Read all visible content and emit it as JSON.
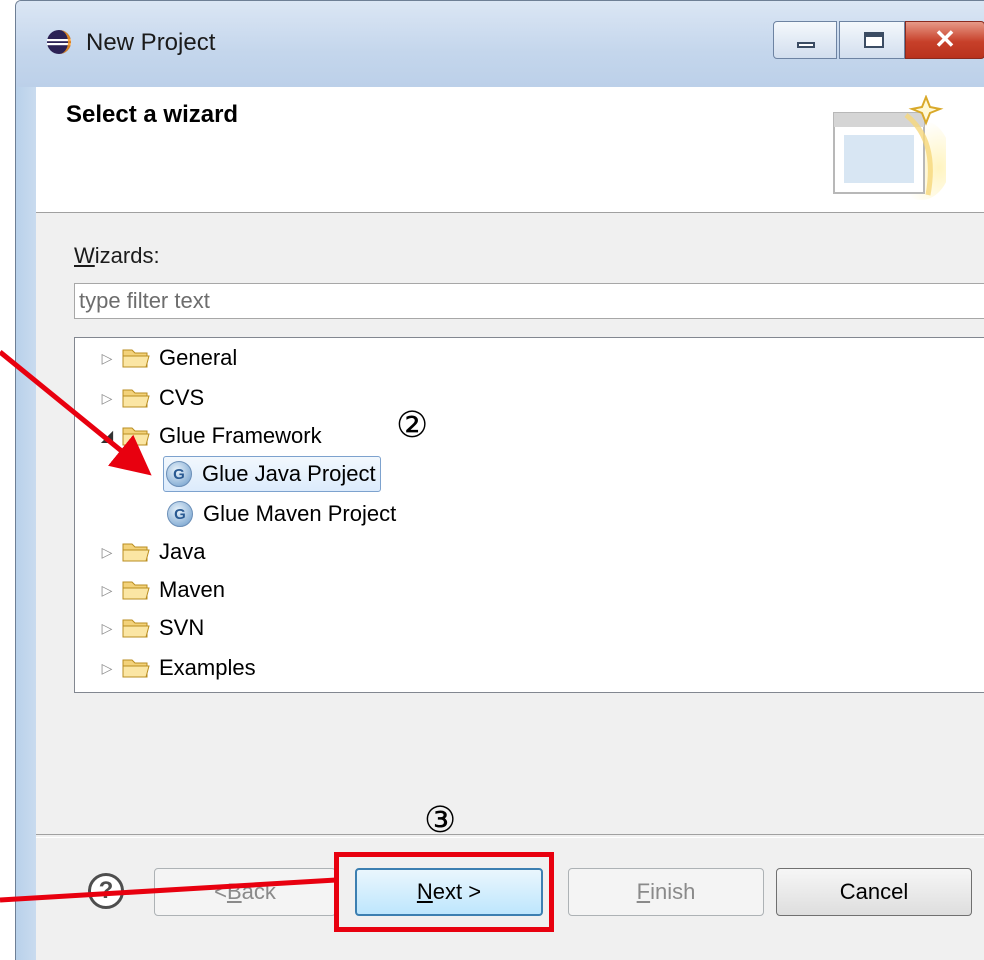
{
  "window": {
    "title": "New Project",
    "buttons": [
      "minimize",
      "maximize",
      "close"
    ],
    "close_glyph": "✕"
  },
  "banner": {
    "title": "Select a wizard"
  },
  "wizards": {
    "label_accel": "W",
    "label_rest": "izards:",
    "filter_placeholder": "type filter text"
  },
  "tree": {
    "items": [
      {
        "label": "General",
        "type": "folder",
        "expanded": false
      },
      {
        "label": "CVS",
        "type": "folder",
        "expanded": false
      },
      {
        "label": "Glue Framework",
        "type": "folder",
        "expanded": true
      },
      {
        "label": "Glue Java Project",
        "type": "wizard",
        "selected": true,
        "icon_letter": "G"
      },
      {
        "label": "Glue Maven Project",
        "type": "wizard",
        "selected": false,
        "icon_letter": "G"
      },
      {
        "label": "Java",
        "type": "folder",
        "expanded": false
      },
      {
        "label": "Maven",
        "type": "folder",
        "expanded": false
      },
      {
        "label": "SVN",
        "type": "folder",
        "expanded": false
      },
      {
        "label": "Examples",
        "type": "folder",
        "expanded": false
      }
    ]
  },
  "buttons": {
    "help": "?",
    "back_prefix": "< ",
    "back_accel": "B",
    "back_rest": "ack",
    "next_accel": "N",
    "next_rest": "ext >",
    "finish_accel": "F",
    "finish_rest": "inish",
    "cancel": "Cancel"
  },
  "annotations": {
    "step2": "②",
    "step3": "③",
    "color": "#e8000f"
  }
}
